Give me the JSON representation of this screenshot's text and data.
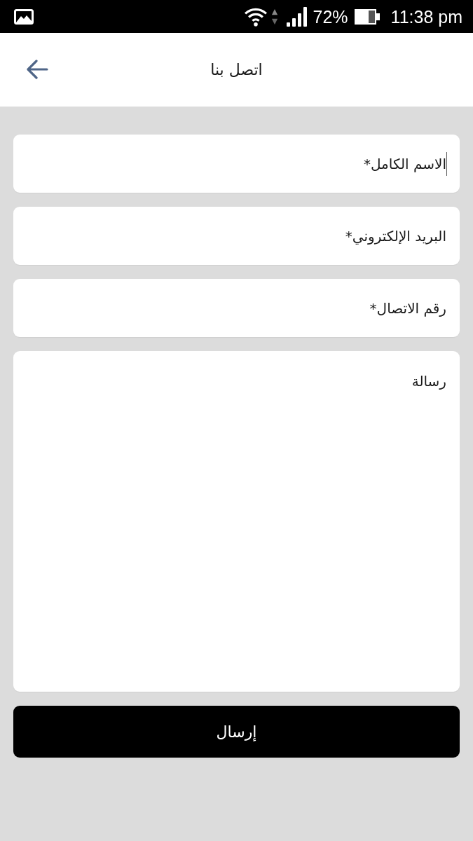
{
  "status_bar": {
    "battery": "72%",
    "time": "11:38 pm"
  },
  "app_bar": {
    "title": "اتصل بنا"
  },
  "form": {
    "fields": [
      {
        "kind": "input",
        "placeholder": "الاسم الكامل*",
        "focused": true
      },
      {
        "kind": "input",
        "placeholder": "البريد الإلكتروني*",
        "focused": false
      },
      {
        "kind": "input",
        "placeholder": "رقم الاتصال*",
        "focused": false
      },
      {
        "kind": "textarea",
        "placeholder": "رسالة",
        "focused": false
      }
    ],
    "submit": {
      "label": "إرسال"
    }
  }
}
